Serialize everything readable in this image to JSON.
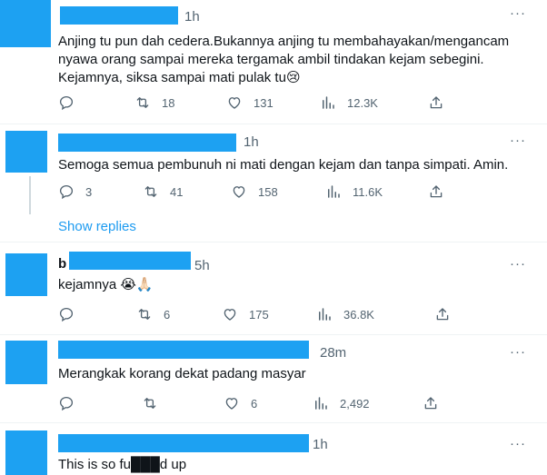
{
  "colors": {
    "accent": "#1d9bf0",
    "redaction": "#1da1f2",
    "muted": "#536471"
  },
  "more_icon": "more-horizontal-icon",
  "tweets": [
    {
      "name_visible": "",
      "time": "1h",
      "lines": [
        "Anjing tu pun dah cedera.Bukannya anjing tu membahayakan/mengancam",
        "nyawa orang sampai mereka tergamak ambil tindakan kejam sebegini.",
        "Kejamnya, siksa sampai mati pulak tu😢"
      ],
      "reply_count": "",
      "retweet_count": "18",
      "like_count": "131",
      "view_count": "12.3K"
    },
    {
      "name_visible": "",
      "time": "1h",
      "lines": [
        "Semoga semua pembunuh ni mati dengan kejam dan tanpa simpati. Amin."
      ],
      "reply_count": "3",
      "retweet_count": "41",
      "like_count": "158",
      "view_count": "11.6K",
      "show_replies": "Show replies"
    },
    {
      "name_visible": "b",
      "time": "5h",
      "lines": [
        "kejamnya 😭🙏🏻"
      ],
      "reply_count": "",
      "retweet_count": "6",
      "like_count": "175",
      "view_count": "36.8K"
    },
    {
      "name_visible": "",
      "time": "28m",
      "lines": [
        "Merangkak korang dekat padang masyar"
      ],
      "reply_count": "",
      "retweet_count": "",
      "like_count": "6",
      "view_count": "2,492"
    },
    {
      "name_visible": "",
      "time": "1h",
      "lines": [
        "This is so fu███d up"
      ],
      "reply_count": "",
      "retweet_count": "",
      "like_count": "",
      "view_count": ""
    }
  ]
}
